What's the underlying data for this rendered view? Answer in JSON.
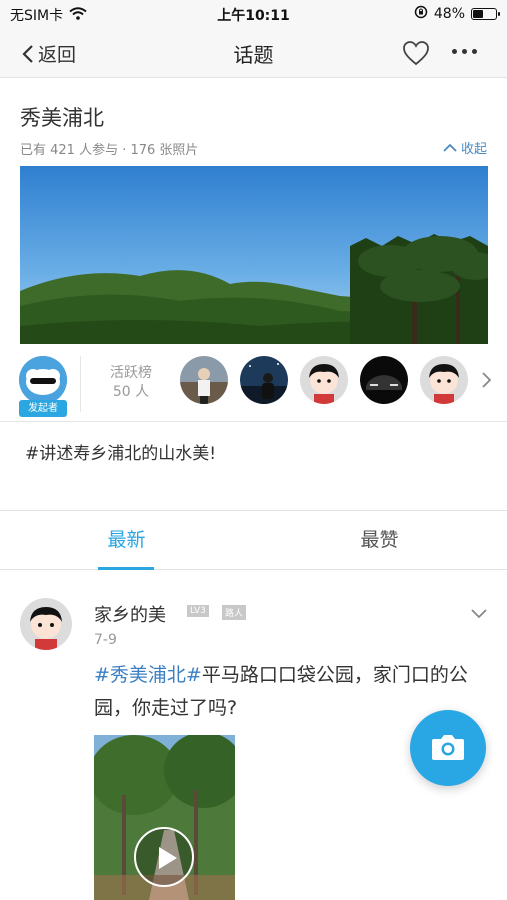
{
  "status_bar": {
    "carrier": "无SIM卡",
    "time": "上午10:11",
    "battery_percent": "48%",
    "battery_level": 0.48
  },
  "nav": {
    "back_label": "返回",
    "title": "话题"
  },
  "topic": {
    "title": "秀美浦北",
    "stats": "已有 421 人参与 · 176 张照片",
    "collapse_label": "收起",
    "description": "#讲述寿乡浦北的山水美!"
  },
  "activity": {
    "starter_label": "发起者",
    "rank_label": "活跃榜",
    "rank_count": "50 人"
  },
  "tabs": [
    {
      "label": "最新",
      "active": true
    },
    {
      "label": "最赞",
      "active": false
    }
  ],
  "post": {
    "username": "家乡的美",
    "level": "LV3",
    "role": "路人",
    "date": "7-9",
    "hashtag": "#秀美浦北#",
    "text": "平马路口口袋公园，家门口的公园，你走过了吗?"
  },
  "colors": {
    "accent": "#2aa6e0",
    "link": "#3b7fc4"
  }
}
